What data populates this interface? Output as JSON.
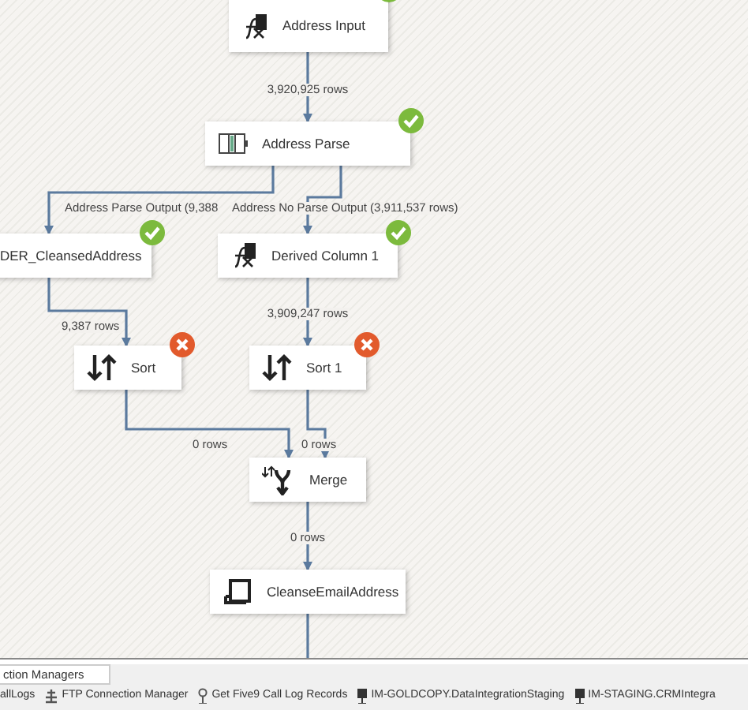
{
  "nodes": [
    {
      "name": "Address Input",
      "kind": "derived-column",
      "succeeded": true,
      "failed": false
    },
    {
      "name": "Address Parse",
      "kind": "parser",
      "succeeded": true,
      "failed": false
    },
    {
      "name": "DER_CleansedAddress",
      "kind": "none",
      "succeeded": true,
      "failed": false
    },
    {
      "name": "Derived Column 1",
      "kind": "derived-column",
      "succeeded": true,
      "failed": false
    },
    {
      "name": "Sort",
      "kind": "sort",
      "succeeded": false,
      "failed": true
    },
    {
      "name": "Sort 1",
      "kind": "sort",
      "succeeded": false,
      "failed": true
    },
    {
      "name": "Merge",
      "kind": "merge",
      "succeeded": false,
      "failed": false
    },
    {
      "name": "CleanseEmailAddress",
      "kind": "script",
      "succeeded": false,
      "failed": false
    }
  ],
  "paths": [
    {
      "label": "3,920,925 rows"
    },
    {
      "label": "Address Parse Output (9,388"
    },
    {
      "label": "Address No Parse Output (3,911,537 rows)"
    },
    {
      "label": "9,387 rows"
    },
    {
      "label": "3,909,247 rows"
    },
    {
      "label": "0 rows"
    },
    {
      "label": "0 rows"
    },
    {
      "label": "0 rows"
    }
  ],
  "connection_managers": {
    "tab": "ction Managers",
    "items": [
      {
        "name": "allLogs",
        "kind": "none"
      },
      {
        "name": "FTP Connection Manager",
        "kind": "ftp"
      },
      {
        "name": "Get Five9 Call Log Records",
        "kind": "http"
      },
      {
        "name": "IM-GOLDCOPY.DataIntegrationStaging",
        "kind": "db"
      },
      {
        "name": "IM-STAGING.CRMIntegra",
        "kind": "db"
      }
    ]
  }
}
